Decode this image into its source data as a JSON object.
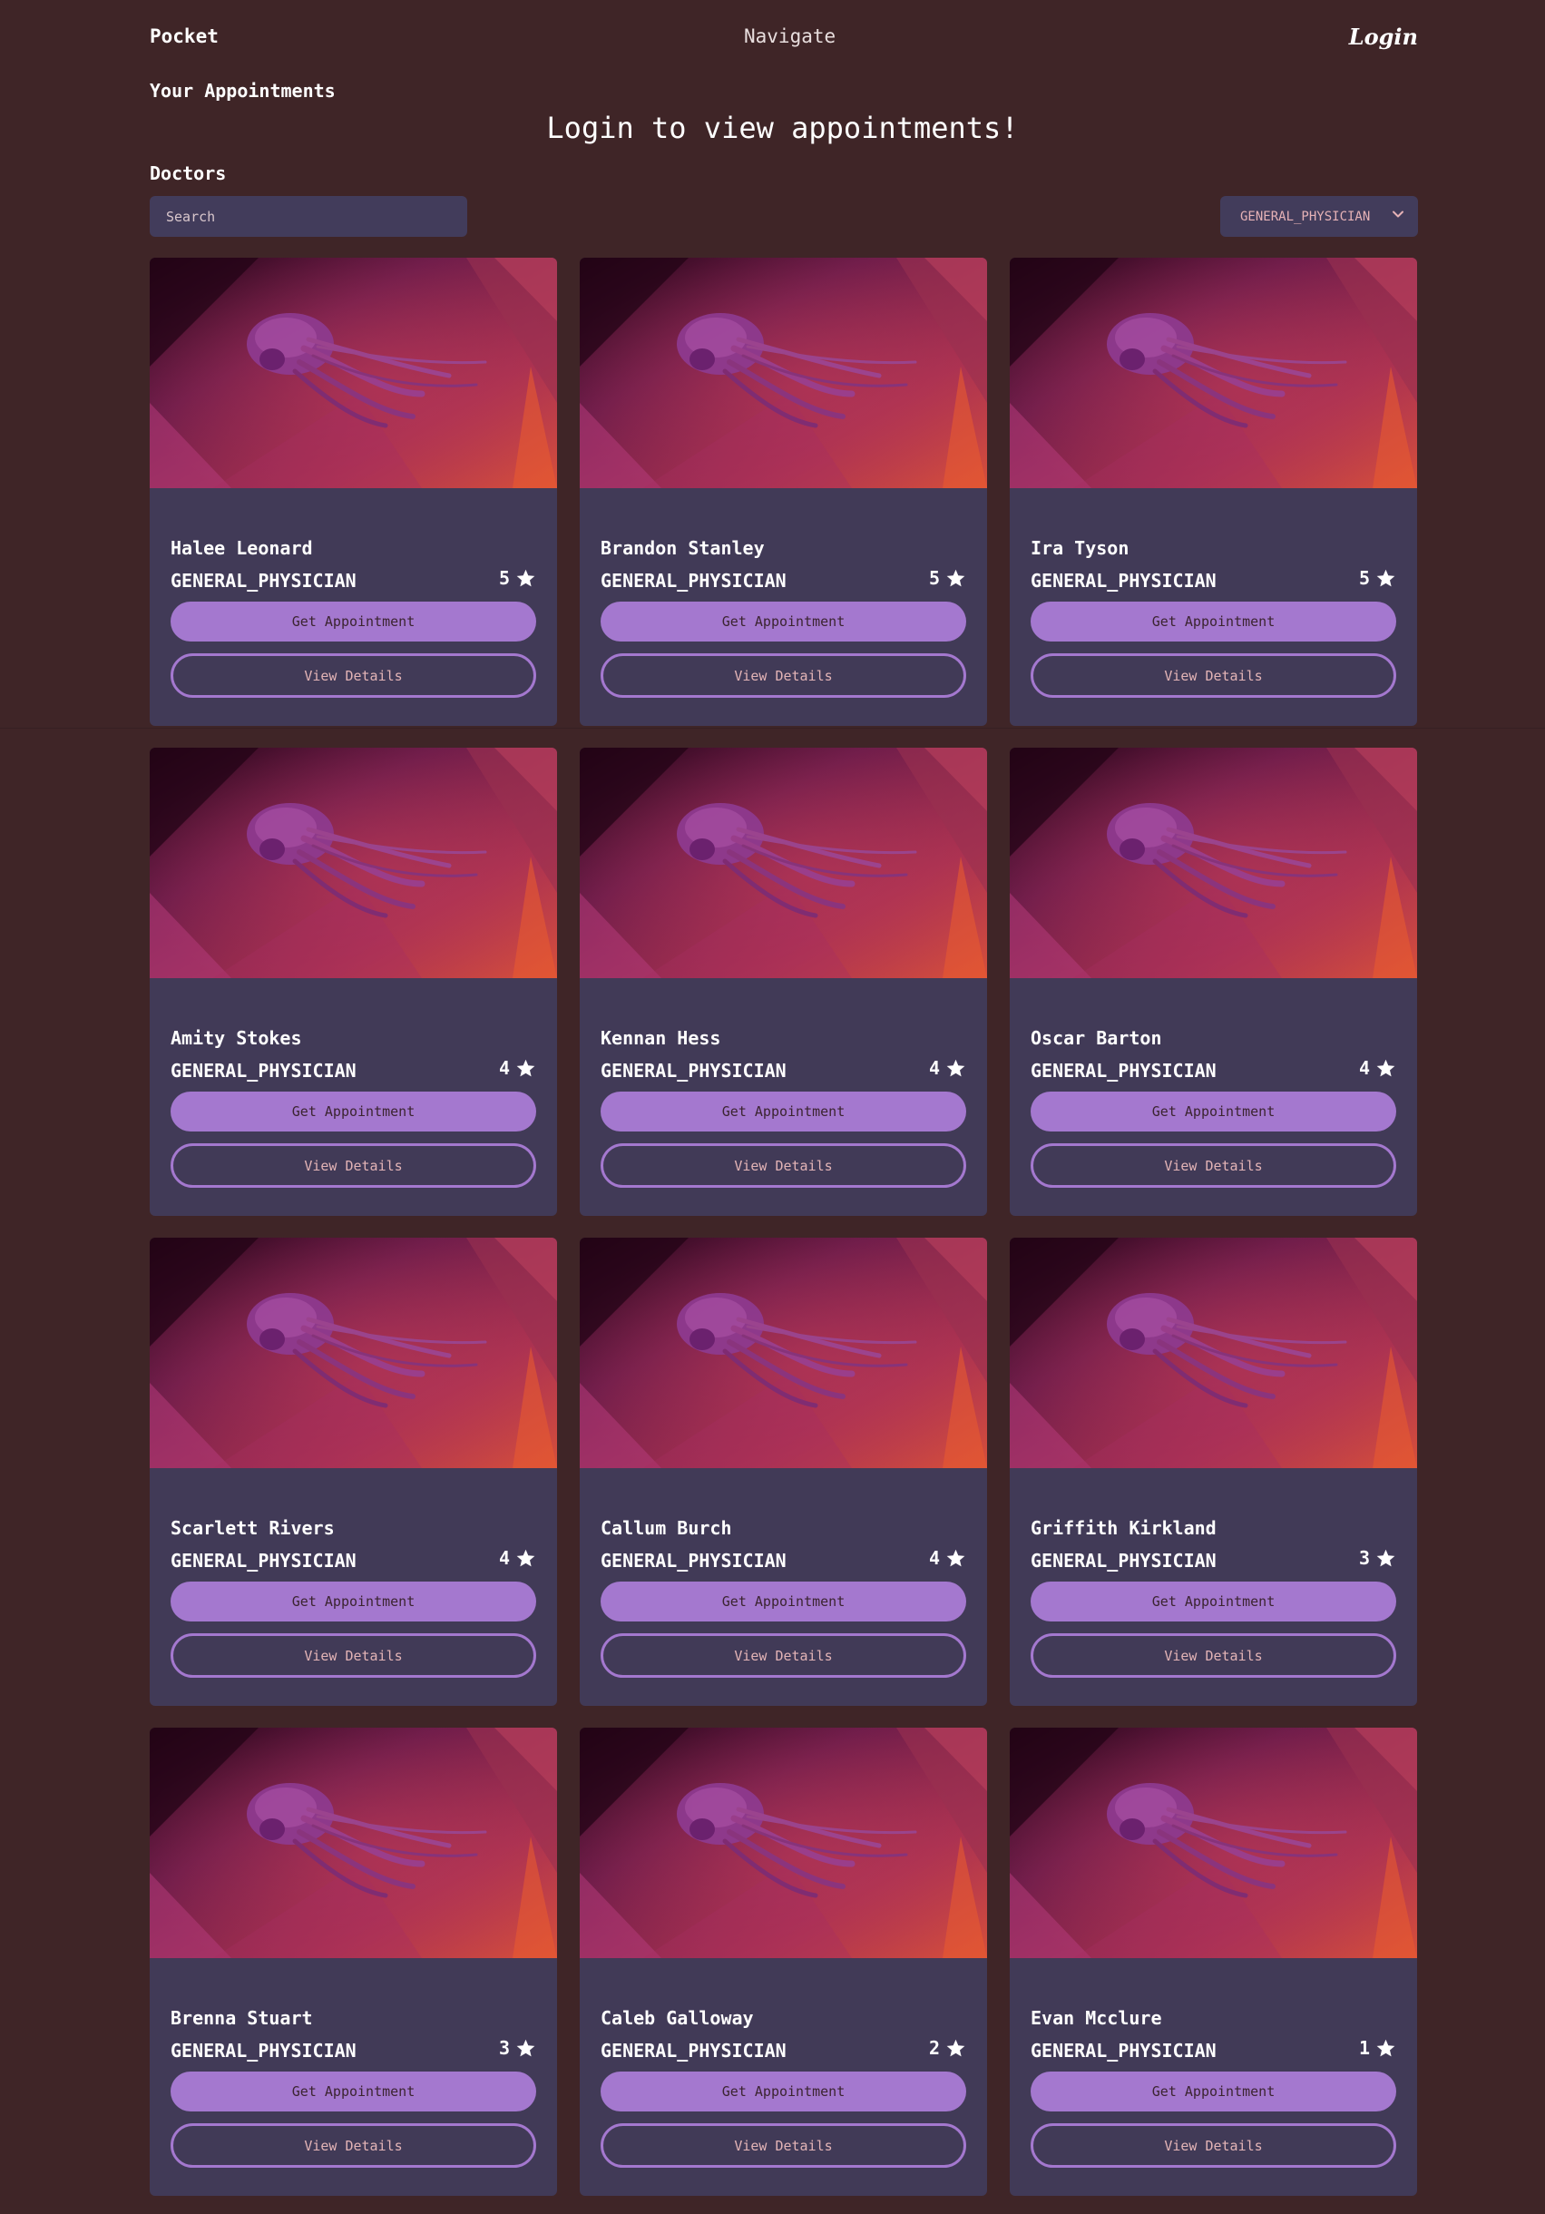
{
  "header": {
    "brand": "Pocket",
    "navigate": "Navigate",
    "login": "Login"
  },
  "appointments": {
    "title": "Your Appointments",
    "message": "Login to view appointments!"
  },
  "doctors": {
    "title": "Doctors",
    "search_placeholder": "Search",
    "filter_value": "GENERAL_PHYSICIAN",
    "get_appointment_label": "Get Appointment",
    "view_details_label": "View Details",
    "list": [
      {
        "name": "Halee Leonard",
        "specialty": "GENERAL_PHYSICIAN",
        "rating": "5"
      },
      {
        "name": "Brandon Stanley",
        "specialty": "GENERAL_PHYSICIAN",
        "rating": "5"
      },
      {
        "name": "Ira Tyson",
        "specialty": "GENERAL_PHYSICIAN",
        "rating": "5"
      },
      {
        "name": "Amity Stokes",
        "specialty": "GENERAL_PHYSICIAN",
        "rating": "4"
      },
      {
        "name": "Kennan Hess",
        "specialty": "GENERAL_PHYSICIAN",
        "rating": "4"
      },
      {
        "name": "Oscar Barton",
        "specialty": "GENERAL_PHYSICIAN",
        "rating": "4"
      },
      {
        "name": "Scarlett Rivers",
        "specialty": "GENERAL_PHYSICIAN",
        "rating": "4"
      },
      {
        "name": "Callum Burch",
        "specialty": "GENERAL_PHYSICIAN",
        "rating": "4"
      },
      {
        "name": "Griffith Kirkland",
        "specialty": "GENERAL_PHYSICIAN",
        "rating": "3"
      },
      {
        "name": "Brenna Stuart",
        "specialty": "GENERAL_PHYSICIAN",
        "rating": "3"
      },
      {
        "name": "Caleb Galloway",
        "specialty": "GENERAL_PHYSICIAN",
        "rating": "2"
      },
      {
        "name": "Evan Mcclure",
        "specialty": "GENERAL_PHYSICIAN",
        "rating": "1"
      }
    ]
  },
  "icons": {
    "rating": "star-icon",
    "filter": "chevron-down-icon",
    "card_image": "jellyfish-wallpaper-image"
  },
  "colors": {
    "page_background": "#3f2527",
    "card_background": "#413a57",
    "accent": "#a478cf"
  }
}
